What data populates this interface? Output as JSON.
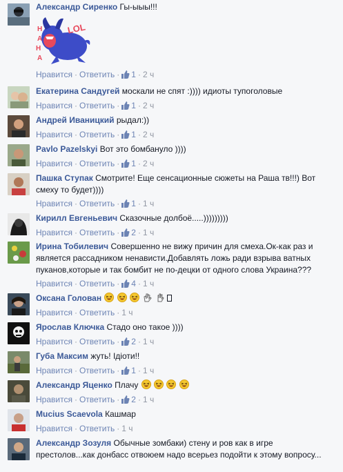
{
  "labels": {
    "like": "Нравится",
    "reply": "Ответить"
  },
  "comments": [
    {
      "author": "Александр Сиренко",
      "text": "Гы-ыыы!!!",
      "likes": "1",
      "time": "2 ч",
      "sticker": "LOL"
    },
    {
      "author": "Екатерина Сандугей",
      "text": "москали не спят :)))) идиоты тупоголовые",
      "likes": "1",
      "time": "2 ч"
    },
    {
      "author": "Андрей Иваницкий",
      "text": "рыдал:))",
      "likes": "1",
      "time": "2 ч"
    },
    {
      "author": "Pavlo Pazelskyi",
      "text": "Вот это бомбануло ))))",
      "likes": "1",
      "time": "2 ч"
    },
    {
      "author": "Пашка Ступак",
      "text": "Смотрите! Еще сенсационные сюжеты на Раша тв!!!) Вот смеху то будет))))",
      "likes": "1",
      "time": "1 ч"
    },
    {
      "author": "Кирилл Евгеньевич",
      "text": "Сказочные долбоё.....)))))))))",
      "likes": "2",
      "time": "1 ч"
    },
    {
      "author": "Ирина Тобилевич",
      "text": "Совершенно не вижу причин для смеха.Ок-как раз и является рассадником ненависти.Добавлять ложь ради взрыва ватных пуканов,которые и так бомбит не по-децки от одного слова Украина???",
      "likes": "4",
      "time": "1 ч"
    },
    {
      "author": "Оксана Голован",
      "text": "",
      "likes": "",
      "time": "1 ч"
    },
    {
      "author": "Ярослав Ключка",
      "text": "Стадо оно такое ))))",
      "likes": "2",
      "time": "1 ч"
    },
    {
      "author": "Губа Максим",
      "text": "жуть! Ідіоти!!",
      "likes": "1",
      "time": "1 ч"
    },
    {
      "author": "Александр Яценко",
      "text": "Плачу",
      "likes": "2",
      "time": "1 ч"
    },
    {
      "author": "Mucius Scaevola",
      "text": "Кашмар",
      "likes": "",
      "time": "1 ч"
    },
    {
      "author": "Александр Зозуля",
      "text": "Обычные зомбаки) стену и ров как в игре престолов...как донбасс отвоюем надо всерьез подойти к этому вопросу..."
    }
  ],
  "icons": {
    "like": "thumbs-up-icon",
    "emoji": "laughing-emoji-icon",
    "hand": "raised-hand-icon",
    "phone": "mobile-phone-icon"
  },
  "colors": {
    "author": "#3b5998",
    "link": "#6d84b4",
    "meta": "#9197a3",
    "background": "#f6f7f9"
  }
}
